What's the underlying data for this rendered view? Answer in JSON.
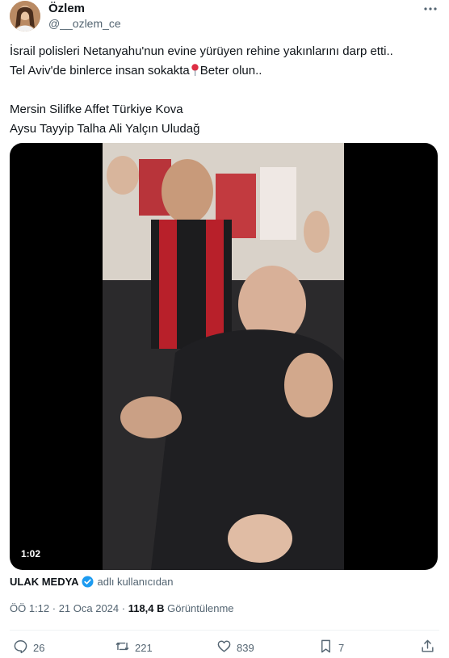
{
  "author": {
    "display_name": "Özlem",
    "handle": "@__ozlem_ce"
  },
  "tweet": {
    "line1": "İsrail polisleri Netanyahu'nun evine yürüyen rehine yakınlarını darp etti..",
    "line2_before": "Tel Aviv'de binlerce insan sokakta",
    "line2_after": "Beter olun..",
    "line3": "Mersin Silifke Affet Türkiye Kova",
    "line4": "Aysu Tayyip Talha Ali Yalçın Uludağ"
  },
  "video": {
    "duration": "1:02"
  },
  "source": {
    "name": "ULAK MEDYA",
    "suffix": "adlı kullanıcıdan"
  },
  "meta": {
    "time_date": "ÖÖ 1:12 · 21 Oca 2024 ·",
    "views_count": "118,4 B",
    "views_label": "Görüntülenme"
  },
  "actions": {
    "replies": "26",
    "reposts": "221",
    "likes": "839",
    "bookmarks": "7"
  },
  "colors": {
    "text": "#0f1419",
    "muted": "#536471",
    "verified": "#1d9bf0"
  }
}
